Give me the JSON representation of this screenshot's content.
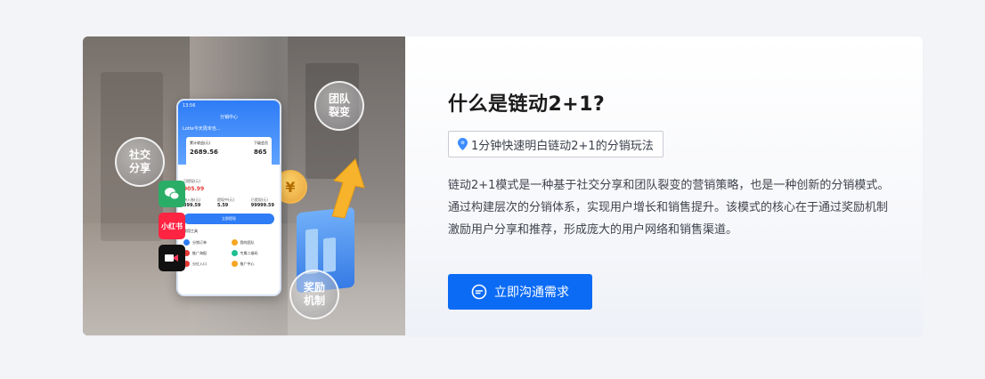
{
  "hero": {
    "bubbles": {
      "social_share": "社交分享",
      "team_fission": "团队裂变",
      "reward_mechanism": "奖励机制"
    },
    "apps": {
      "xiaohongshu": "小红书"
    },
    "phone": {
      "time": "13:56",
      "header": "分销中心",
      "user": "Lotte今天周末也...",
      "stat1_label": "累计收益(元)",
      "stat1_value": "2689.56",
      "stat2_label": "下级会员",
      "stat2_value": "865",
      "withdraw_label": "可提现(元)",
      "withdraw_value": "905.99",
      "row": [
        {
          "label": "待入账(元)",
          "value": "399.59"
        },
        {
          "label": "提现中(元)",
          "value": "5.59"
        },
        {
          "label": "已提现(元)",
          "value": "99999.59"
        }
      ],
      "button": "立即提现",
      "tools_title": "常用工具",
      "tools": [
        {
          "name": "分销订单",
          "color": "#2e7cf6"
        },
        {
          "name": "我的团队",
          "color": "#f5a623"
        },
        {
          "name": "推广海报",
          "color": "#e53935"
        },
        {
          "name": "专属二维码",
          "color": "#1fbf8f"
        },
        {
          "name": "分红入口",
          "color": "#e53935"
        },
        {
          "name": "推广中心",
          "color": "#f5a623"
        }
      ]
    }
  },
  "content": {
    "title": "什么是链动2+1?",
    "tag": "1分钟快速明白链动2+1的分销玩法",
    "description": [
      "链动2+1模式是一种基于社交分享和团队裂变的营销策略，也是一种创新的分销模式。",
      "通过构建层次的分销体系，实现用户增长和销售提升。该模式的核心在于通过奖励机制",
      "激励用户分享和推荐，形成庞大的用户网络和销售渠道。"
    ],
    "cta_label": "立即沟通需求"
  },
  "colors": {
    "accent": "#0b6bf5",
    "page_bg": "#f3f4f8"
  }
}
